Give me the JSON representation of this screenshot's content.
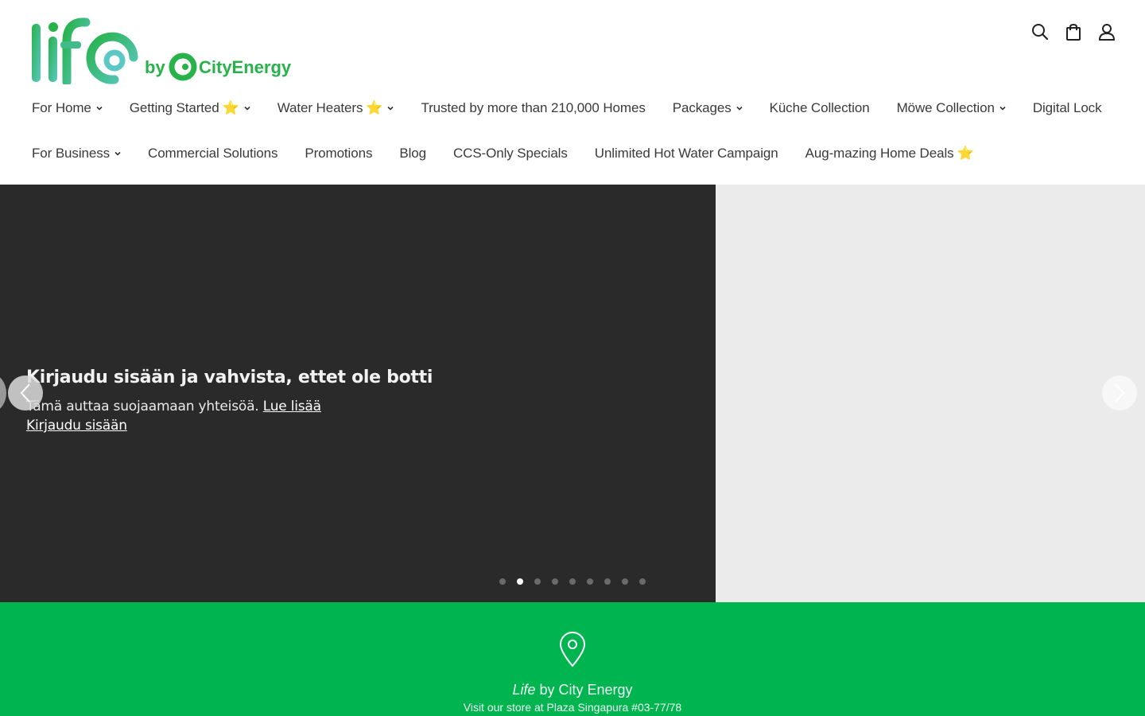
{
  "brand": {
    "logo_word": "life",
    "logo_by": "by",
    "logo_company": "CityEnergy",
    "colors": {
      "green": "#00b450",
      "teal": "#5bc8c4",
      "logo_green": "#27b24a"
    }
  },
  "header_icons": [
    "search-icon",
    "bag-icon",
    "account-icon"
  ],
  "nav": {
    "row1": [
      {
        "label": "For Home",
        "dropdown": true,
        "star": ""
      },
      {
        "label": "Getting Started",
        "dropdown": true,
        "star": "⭐"
      },
      {
        "label": "Water Heaters",
        "dropdown": true,
        "star": "⭐"
      },
      {
        "label": "Trusted by more than 210,000 Homes",
        "dropdown": false,
        "star": ""
      },
      {
        "label": "Packages",
        "dropdown": true,
        "star": ""
      },
      {
        "label": "Küche Collection",
        "dropdown": false,
        "star": ""
      },
      {
        "label": "Möwe Collection",
        "dropdown": true,
        "star": ""
      },
      {
        "label": "Digital Lock",
        "dropdown": false,
        "star": ""
      }
    ],
    "row2": [
      {
        "label": "For Business",
        "dropdown": true,
        "star": ""
      },
      {
        "label": "Commercial Solutions",
        "dropdown": false,
        "star": ""
      },
      {
        "label": "Promotions",
        "dropdown": false,
        "star": ""
      },
      {
        "label": "Blog",
        "dropdown": false,
        "star": ""
      },
      {
        "label": "CCS-Only Specials",
        "dropdown": false,
        "star": ""
      },
      {
        "label": "Unlimited Hot Water Campaign",
        "dropdown": false,
        "star": ""
      },
      {
        "label": "Aug-mazing Home Deals",
        "dropdown": false,
        "star": "⭐"
      }
    ]
  },
  "notice": {
    "title": "Kirjaudu sisään ja vahvista, ettet ole botti",
    "text": "Tämä auttaa suojaamaan yhteisöä.",
    "learn_more": "Lue lisää",
    "sign_in": "Kirjaudu sisään"
  },
  "slideshow": {
    "dot_count": 9,
    "active_dot": 1
  },
  "store": {
    "title_em": "Life",
    "title_rest": " by City Energy",
    "subtitle": "Visit our store at Plaza Singapura #03-77/78"
  }
}
